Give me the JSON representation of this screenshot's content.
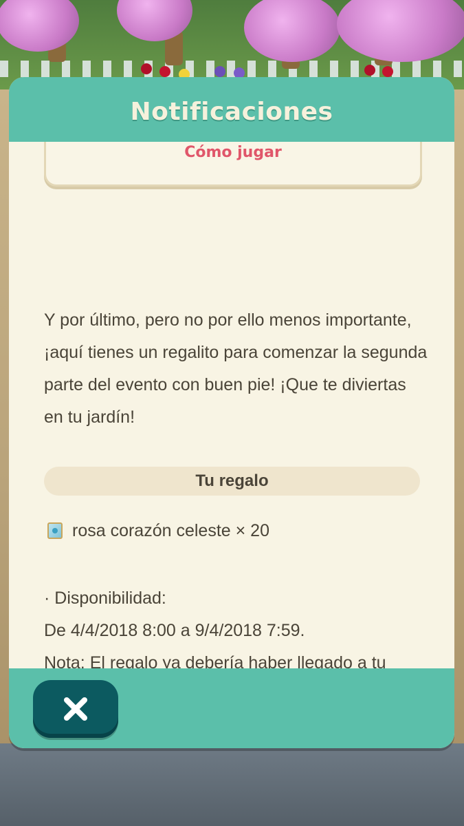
{
  "dialog": {
    "title": "Notificaciones",
    "how_to_link": "Cómo jugar",
    "paragraph": "Y por último, pero no por ello menos importante, ¡aquí tienes un regalito para comenzar la segunda parte del evento con buen pie! ¡Que te diviertas en tu jardín!",
    "gift": {
      "header": "Tu regalo",
      "item_icon": "seed-packet-icon",
      "item_text": "rosa corazón celeste × 20"
    },
    "availability": {
      "label": "· Disponibilidad:",
      "dates": "De 4/4/2018 8:00 a 9/4/2018 7:59.",
      "note": "Nota: El regalo ya debería haber llegado a tu buzón."
    },
    "close_icon": "close-icon"
  },
  "colors": {
    "header_teal": "#5bbfaa",
    "body_cream": "#f8f4e4",
    "close_button": "#0c5a60",
    "link_red": "#e0566a",
    "text_brown": "#4a4438"
  }
}
